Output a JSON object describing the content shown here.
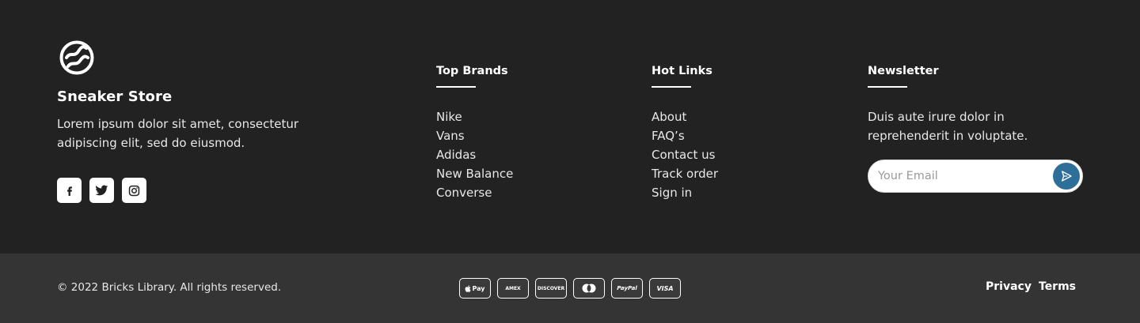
{
  "brand": {
    "name": "Sneaker Store",
    "description": "Lorem ipsum dolor sit amet, consectetur adipiscing elit, sed do eiusmod.",
    "logo_icon": "wave-circle-icon",
    "socials": [
      {
        "icon": "facebook-icon"
      },
      {
        "icon": "twitter-icon"
      },
      {
        "icon": "instagram-icon"
      }
    ]
  },
  "top_brands": {
    "title": "Top Brands",
    "items": [
      "Nike",
      "Vans",
      "Adidas",
      "New Balance",
      "Converse"
    ]
  },
  "hot_links": {
    "title": "Hot Links",
    "items": [
      "About",
      "FAQ’s",
      "Contact us",
      "Track order",
      "Sign in"
    ]
  },
  "newsletter": {
    "title": "Newsletter",
    "description": "Duis aute irure dolor in reprehenderit in voluptate.",
    "email_placeholder": "Your Email",
    "email_value": "",
    "send_icon": "send-arrow-icon",
    "send_button_color": "#2d6f98"
  },
  "bottom": {
    "copyright": "© 2022 Bricks Library. All rights reserved.",
    "payments": [
      "Pay",
      "AMEX",
      "DISCOVER",
      "",
      "PayPal",
      "VISA"
    ],
    "links": {
      "privacy": "Privacy",
      "terms": "Terms"
    }
  },
  "colors": {
    "background": "#222222",
    "bottom_background": "#343434",
    "accent": "#2d6f98"
  }
}
